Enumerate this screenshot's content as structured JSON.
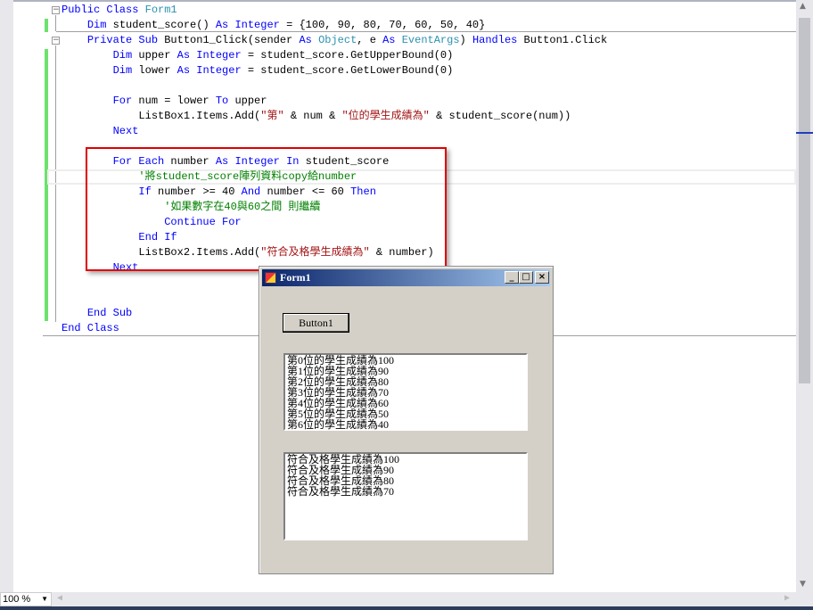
{
  "code_lines": [
    [
      [
        "Public Class ",
        "kw"
      ],
      [
        "Form1",
        "ty"
      ]
    ],
    [
      [
        "    "
      ],
      [
        "Dim",
        "kw"
      ],
      [
        " student_score() "
      ],
      [
        "As",
        "kw"
      ],
      [
        " "
      ],
      [
        "Integer",
        "kw"
      ],
      [
        " = {100, 90, 80, 70, 60, 50, 40}"
      ]
    ],
    [
      [
        "    "
      ],
      [
        "Private Sub",
        "kw"
      ],
      [
        " Button1_Click(sender "
      ],
      [
        "As",
        "kw"
      ],
      [
        " "
      ],
      [
        "Object",
        "ty"
      ],
      [
        ", e "
      ],
      [
        "As",
        "kw"
      ],
      [
        " "
      ],
      [
        "EventArgs",
        "ty"
      ],
      [
        ") "
      ],
      [
        "Handles",
        "kw"
      ],
      [
        " Button1.Click"
      ]
    ],
    [
      [
        "        "
      ],
      [
        "Dim",
        "kw"
      ],
      [
        " upper "
      ],
      [
        "As",
        "kw"
      ],
      [
        " "
      ],
      [
        "Integer",
        "kw"
      ],
      [
        " = student_score.GetUpperBound(0)"
      ]
    ],
    [
      [
        "        "
      ],
      [
        "Dim",
        "kw"
      ],
      [
        " lower "
      ],
      [
        "As",
        "kw"
      ],
      [
        " "
      ],
      [
        "Integer",
        "kw"
      ],
      [
        " = student_score.GetLowerBound(0)"
      ]
    ],
    [],
    [
      [
        "        "
      ],
      [
        "For",
        "kw"
      ],
      [
        " num = lower "
      ],
      [
        "To",
        "kw"
      ],
      [
        " upper"
      ]
    ],
    [
      [
        "            ListBox1.Items.Add("
      ],
      [
        "\"第\"",
        "st"
      ],
      [
        " & num & "
      ],
      [
        "\"位的學生成績為\"",
        "st"
      ],
      [
        " & student_score(num))"
      ]
    ],
    [
      [
        "        "
      ],
      [
        "Next",
        "kw"
      ]
    ],
    [],
    [
      [
        "        "
      ],
      [
        "For Each",
        "kw"
      ],
      [
        " number "
      ],
      [
        "As",
        "kw"
      ],
      [
        " "
      ],
      [
        "Integer",
        "kw"
      ],
      [
        " "
      ],
      [
        "In",
        "kw"
      ],
      [
        " student_score"
      ]
    ],
    [
      [
        "            "
      ],
      [
        "'將student_score陣列資料copy給number",
        "cm"
      ]
    ],
    [
      [
        "            "
      ],
      [
        "If",
        "kw"
      ],
      [
        " number >= 40 "
      ],
      [
        "And",
        "kw"
      ],
      [
        " number <= 60 "
      ],
      [
        "Then",
        "kw"
      ]
    ],
    [
      [
        "                "
      ],
      [
        "'如果數字在40與60之間 則繼續",
        "cm"
      ]
    ],
    [
      [
        "                "
      ],
      [
        "Continue For",
        "kw"
      ]
    ],
    [
      [
        "            "
      ],
      [
        "End If",
        "kw"
      ]
    ],
    [
      [
        "            ListBox2.Items.Add("
      ],
      [
        "\"符合及格學生成績為\"",
        "st"
      ],
      [
        " & number)"
      ]
    ],
    [
      [
        "        "
      ],
      [
        "Next",
        "kw"
      ]
    ],
    [],
    [],
    [
      [
        "    "
      ],
      [
        "End Sub",
        "kw"
      ]
    ],
    [
      [
        "End Class",
        "kw"
      ]
    ]
  ],
  "statusbar": {
    "zoom": "100 %"
  },
  "form": {
    "title": "Form1",
    "button_label": "Button1",
    "listbox1": [
      "第0位的學生成績為100",
      "第1位的學生成績為90",
      "第2位的學生成績為80",
      "第3位的學生成績為70",
      "第4位的學生成績為60",
      "第5位的學生成績為50",
      "第6位的學生成績為40"
    ],
    "listbox2": [
      "符合及格學生成績為100",
      "符合及格學生成績為90",
      "符合及格學生成績為80",
      "符合及格學生成績為70"
    ],
    "min": "_",
    "max": "□",
    "close": "×"
  },
  "colors": {
    "keyword": "#0000ff",
    "type": "#2b91af",
    "string": "#a31515",
    "comment": "#008000",
    "highlight": "#e00000"
  }
}
